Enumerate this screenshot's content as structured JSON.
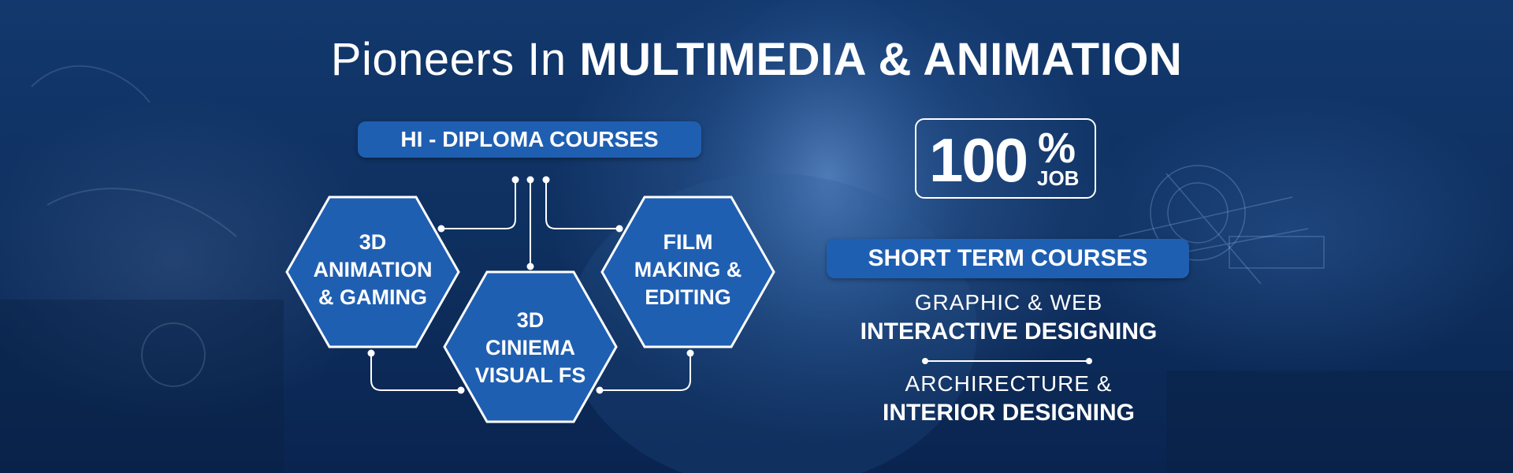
{
  "banner": {
    "title_light": "Pioneers In",
    "title_bold": "MULTIMEDIA & ANIMATION"
  },
  "diploma": {
    "heading": "HI - DIPLOMA COURSES",
    "courses": [
      {
        "lines": [
          "3D",
          "ANIMATION",
          "& GAMING"
        ]
      },
      {
        "lines": [
          "3D",
          "CINIEMA",
          "VISUAL FS"
        ]
      },
      {
        "lines": [
          "FILM",
          "MAKING &",
          "EDITING"
        ]
      }
    ]
  },
  "job_badge": {
    "number": "100",
    "percent": "%",
    "word": "JOB"
  },
  "short_term": {
    "heading": "SHORT TERM COURSES",
    "courses": [
      {
        "line1": "GRAPHIC & WEB",
        "line2": "INTERACTIVE DESIGNING"
      },
      {
        "line1": "ARCHIRECTURE &",
        "line2": "INTERIOR DESIGNING"
      }
    ]
  },
  "colors": {
    "accent_blue": "#1f5fb2",
    "background": "#0e2f5e",
    "text": "#ffffff"
  }
}
